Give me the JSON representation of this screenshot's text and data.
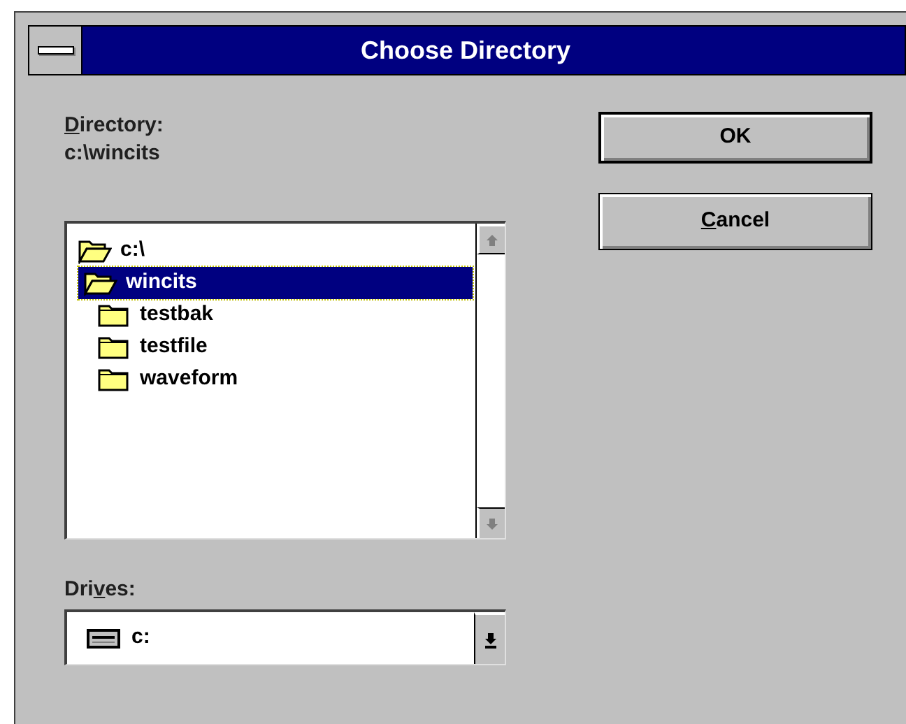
{
  "window": {
    "title": "Choose Directory"
  },
  "directory": {
    "label": {
      "key": "D",
      "post": "irectory:"
    },
    "path": "c:\\wincits"
  },
  "tree": [
    {
      "label": "c:\\",
      "kind": "open",
      "selected": false,
      "children": [
        {
          "label": "wincits",
          "kind": "open",
          "selected": true,
          "children": [
            {
              "label": "testbak",
              "kind": "closed",
              "selected": false
            },
            {
              "label": "testfile",
              "kind": "closed",
              "selected": false
            },
            {
              "label": "waveform",
              "kind": "closed",
              "selected": false
            }
          ]
        }
      ]
    }
  ],
  "drives": {
    "label": {
      "pre": "Dri",
      "key": "v",
      "post": "es:"
    },
    "value": "c:"
  },
  "buttons": [
    {
      "label": {
        "pre": "OK"
      },
      "default": true
    },
    {
      "label": {
        "key": "C",
        "post": "ancel"
      },
      "default": false
    }
  ]
}
